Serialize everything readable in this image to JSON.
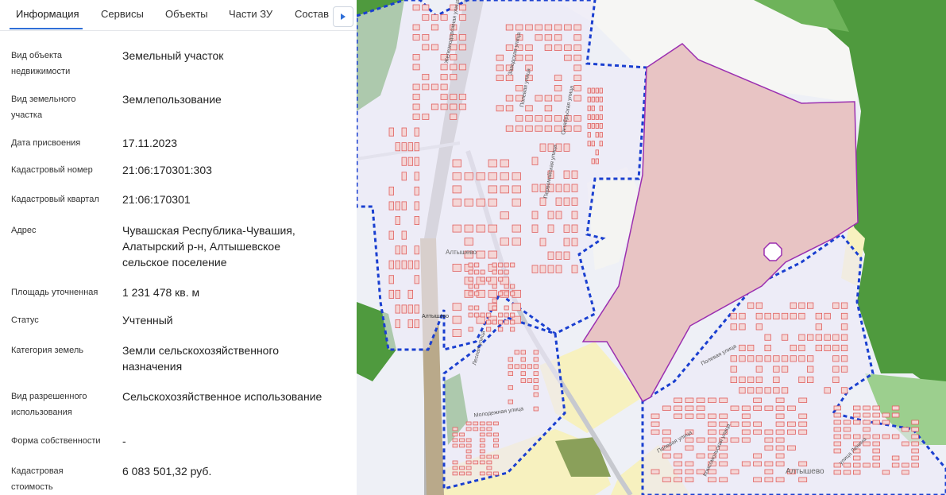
{
  "tabs": [
    "Информация",
    "Сервисы",
    "Объекты",
    "Части ЗУ",
    "Состав"
  ],
  "fields": [
    {
      "label": [
        "Вид объекта",
        "недвижимости"
      ],
      "value": [
        "Земельный участок"
      ]
    },
    {
      "label": [
        "Вид земельного",
        "участка"
      ],
      "value": [
        "Землепользование"
      ]
    },
    {
      "label": [
        "Дата присвоения"
      ],
      "value": [
        "17.11.2023"
      ]
    },
    {
      "label": [
        "Кадастровый номер"
      ],
      "value": [
        "21:06:170301:303"
      ]
    },
    {
      "label": [
        "Кадастровый квартал"
      ],
      "value": [
        "21:06:170301"
      ]
    },
    {
      "label": [
        "Адрес"
      ],
      "value": [
        "Чувашская Республика-Чувашия,",
        "Алатырский р-н, Алтышевское",
        "сельское поселение"
      ]
    },
    {
      "label": [
        "Площадь уточненная"
      ],
      "value": [
        "1 231 478 кв. м"
      ]
    },
    {
      "label": [
        "Статус"
      ],
      "value": [
        "Учтенный"
      ]
    },
    {
      "label": [
        "Категория земель"
      ],
      "value": [
        "Земли сельскохозяйственного",
        "назначения"
      ]
    },
    {
      "label": [
        "Вид разрешенного",
        "использования"
      ],
      "value": [
        "Сельскохозяйственное использование"
      ]
    },
    {
      "label": [
        "Форма собственности"
      ],
      "value": [
        "-"
      ]
    },
    {
      "label": [
        "Кадастровая",
        "стоимость"
      ],
      "value": [
        "6 083 501,32 руб."
      ]
    }
  ],
  "map": {
    "place_labels": [
      "Алтышево",
      "Алтышево",
      "Алтышево"
    ],
    "street_labels": [
      "Полевая улица",
      "Заводская улица",
      "Октябрьская улица",
      "Первомайская улица",
      "Лесная улица",
      "Молодежная улица",
      "Полевая улица",
      "улица Ленина",
      "Комсомольская улица",
      "Полевая улица",
      "Железнодорожная улица"
    ],
    "colors": {
      "selected_parcel_fill": "#e8c4c4",
      "selected_parcel_stroke": "#9b2fb0",
      "settlement_boundary": "#1a3fd0",
      "forest": "#4f9a3e",
      "field_yellow": "#f7f1bf",
      "building_stroke": "#e0605f"
    }
  }
}
